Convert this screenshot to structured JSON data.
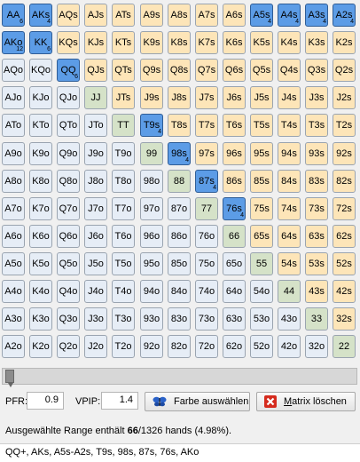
{
  "ranks": [
    "A",
    "K",
    "Q",
    "J",
    "T",
    "9",
    "8",
    "7",
    "6",
    "5",
    "4",
    "3",
    "2"
  ],
  "colors": {
    "pair": "#d5e2c8",
    "suited": "#fde5b8",
    "offsuit": "#e6edf6",
    "selected": "#5c9ce6"
  },
  "selected": {
    "AA": "6",
    "AKs": "4",
    "A5s": "4",
    "A4s": "4",
    "A3s": "4",
    "A2s": "4",
    "AKo": "12",
    "KK": "6",
    "QQ": "6",
    "T9s": "4",
    "98s": "4",
    "87s": "4",
    "76s": "4"
  },
  "controls": {
    "pfr_label": "PFR:",
    "pfr_value": "0.9",
    "vpip_label": "VPIP:",
    "vpip_value": "1.4",
    "color_button": "Farbe auswählen",
    "clear_button": "Matrix löschen",
    "color_icon": "butterfly-icon",
    "clear_icon": "red-x-icon"
  },
  "slider": {
    "value": 0
  },
  "summary": {
    "prefix": "Ausgewählte Range enthält ",
    "count": "66",
    "suffix": "/1326 hands (4.98%)."
  },
  "hand_list": "QQ+, AKs, A5s-A2s, T9s, 98s, 87s, 76s, AKo"
}
